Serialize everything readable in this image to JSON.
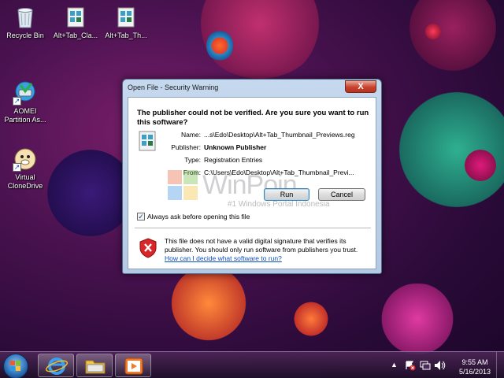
{
  "desktop": {
    "icons": [
      {
        "label": "Recycle Bin"
      },
      {
        "label": "Alt+Tab_Cla..."
      },
      {
        "label": "Alt+Tab_Th..."
      },
      {
        "label": "AOMEI Partition As..."
      },
      {
        "label": "Virtual CloneDrive"
      }
    ]
  },
  "dialog": {
    "title": "Open File - Security Warning",
    "close_label": "X",
    "question": "The publisher could not be verified.  Are you sure you want to run this software?",
    "fields": {
      "name_label": "Name:",
      "name_value": "...s\\Edo\\Desktop\\Alt+Tab_Thumbnail_Previews.reg",
      "publisher_label": "Publisher:",
      "publisher_value": "Unknown Publisher",
      "type_label": "Type:",
      "type_value": "Registration Entries",
      "from_label": "From:",
      "from_value": "C:\\Users\\Edo\\Desktop\\Alt+Tab_Thumbnail_Previ..."
    },
    "run_label": "Run",
    "cancel_label": "Cancel",
    "always_ask_label": "Always ask before opening this file",
    "always_ask_checked": true,
    "warning_text": "This file does not have a valid digital signature that verifies its publisher.  You should only run software from publishers you trust.",
    "help_link": "How can I decide what software to run?"
  },
  "watermark": {
    "brand": "WinPoin",
    "tagline": "#1 Windows Portal Indonesia"
  },
  "taskbar": {
    "pinned": [
      "internet-explorer-icon",
      "windows-explorer-icon",
      "media-player-icon"
    ],
    "clock_time": "9:55 AM",
    "clock_date": "5/16/2013"
  }
}
